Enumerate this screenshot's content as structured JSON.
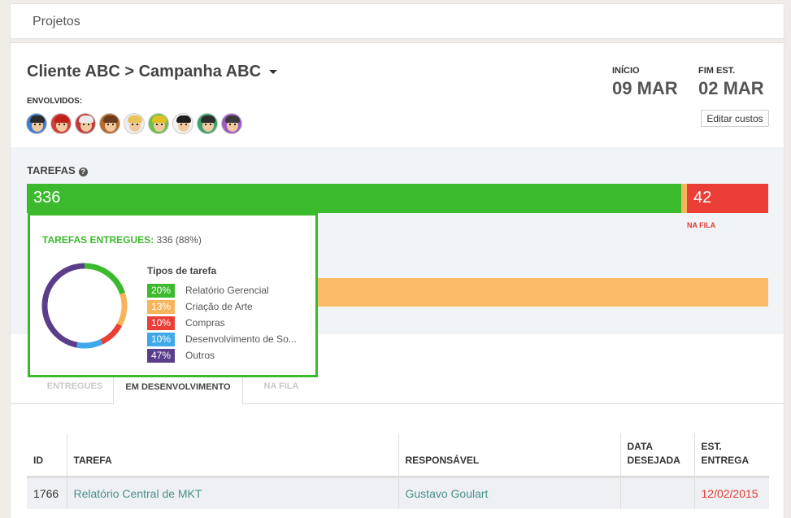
{
  "topbar": {
    "breadcrumb": "Projetos"
  },
  "project": {
    "title": "Cliente ABC > Campanha ABC",
    "involved_label": "ENVOLVIDOS:",
    "avatars": [
      {
        "hair": "#2b2b2b",
        "bg": "#3b7bd4"
      },
      {
        "hair": "#c0201a",
        "bg": "#d23c3c"
      },
      {
        "hair": "#eaeaea",
        "bg": "#c23b3b"
      },
      {
        "hair": "#6b3d1d",
        "bg": "#b56a2e"
      },
      {
        "hair": "#e8c35a",
        "bg": "#eeeeee"
      },
      {
        "hair": "#e0c020",
        "bg": "#6ac04a"
      },
      {
        "hair": "#1e1e1e",
        "bg": "#f3f3f3"
      },
      {
        "hair": "#2d2d2d",
        "bg": "#3aa36a"
      },
      {
        "hair": "#3b3b3b",
        "bg": "#9c5ac2"
      }
    ]
  },
  "dates": {
    "start_label": "INÍCIO",
    "start_value": "09 MAR",
    "end_label": "FIM EST.",
    "end_value": "02 MAR",
    "edit_costs_label": "Editar custos"
  },
  "tasks": {
    "title": "TAREFAS",
    "delivered_count": "336",
    "queued_count": "42",
    "queued_label": "NA FILA",
    "colors": {
      "delivered": "#3cba2d",
      "in_progress": "#f7b45a",
      "queued": "#ea3e36"
    }
  },
  "popover": {
    "heading_label": "TAREFAS ENTREGUES:",
    "heading_value": "336 (88%)",
    "legend_title": "Tipos de tarefa",
    "items": [
      {
        "pct": "20%",
        "value": 20,
        "name": "Relatório Gerencial",
        "color": "#3cba2d"
      },
      {
        "pct": "13%",
        "value": 13,
        "name": "Criação de Arte",
        "color": "#f7b45a"
      },
      {
        "pct": "10%",
        "value": 10,
        "name": "Compras",
        "color": "#ea3e36"
      },
      {
        "pct": "10%",
        "value": 10,
        "name": "Desenvolvimento de So...",
        "color": "#3fa8e8"
      },
      {
        "pct": "47%",
        "value": 47,
        "name": "Outros",
        "color": "#5a3e8c"
      }
    ]
  },
  "tabs": [
    {
      "label": "ENTREGUES"
    },
    {
      "label": "EM DESENVOLVIMENTO"
    },
    {
      "label": "NA FILA"
    }
  ],
  "table": {
    "headers": [
      "ID",
      "TAREFA",
      "RESPONSÁVEL",
      "DATA DESEJADA",
      "EST. ENTREGA"
    ],
    "rows": [
      {
        "id": "1766",
        "task": "Relatório Central de MKT",
        "owner": "Gustavo Goulart",
        "desired": "",
        "eta": "12/02/2015"
      }
    ]
  }
}
